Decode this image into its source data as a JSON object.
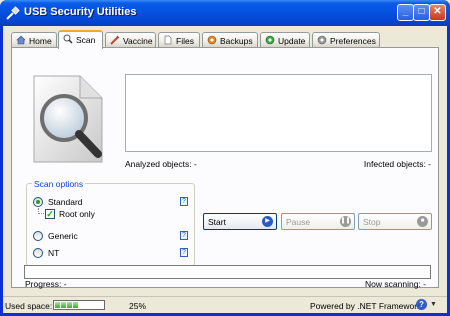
{
  "window": {
    "title": "USB Security Utilities"
  },
  "tabs": [
    {
      "label": "Home",
      "icon": "home-icon"
    },
    {
      "label": "Scan",
      "icon": "magnifier-icon",
      "active": true
    },
    {
      "label": "Vaccine",
      "icon": "syringe-icon"
    },
    {
      "label": "Files",
      "icon": "file-icon"
    },
    {
      "label": "Backups",
      "icon": "gear-icon"
    },
    {
      "label": "Update",
      "icon": "globe-icon"
    },
    {
      "label": "Preferences",
      "icon": "gear-icon"
    }
  ],
  "scan": {
    "analyzed_label": "Analyzed objects: -",
    "infected_label": "Infected objects: -",
    "options_title": "Scan options",
    "options": {
      "standard": "Standard",
      "root_only": "Root only",
      "generic": "Generic",
      "nt": "NT"
    },
    "help": "?",
    "selected_option": "Standard",
    "root_only_checked": true,
    "buttons": {
      "start": "Start",
      "pause": "Pause",
      "stop": "Stop"
    },
    "progress_label": "Progress: -",
    "now_scanning_label": "Now scanning: -"
  },
  "status": {
    "used_space_label": "Used space:",
    "used_space_value": "25%",
    "used_space_fraction": 0.25,
    "powered_by": "Powered by .NET Framework",
    "help": "?"
  },
  "colors": {
    "title_bar": "#0550E0",
    "accent": "#21A121",
    "active_tab": "#F7A91E"
  }
}
